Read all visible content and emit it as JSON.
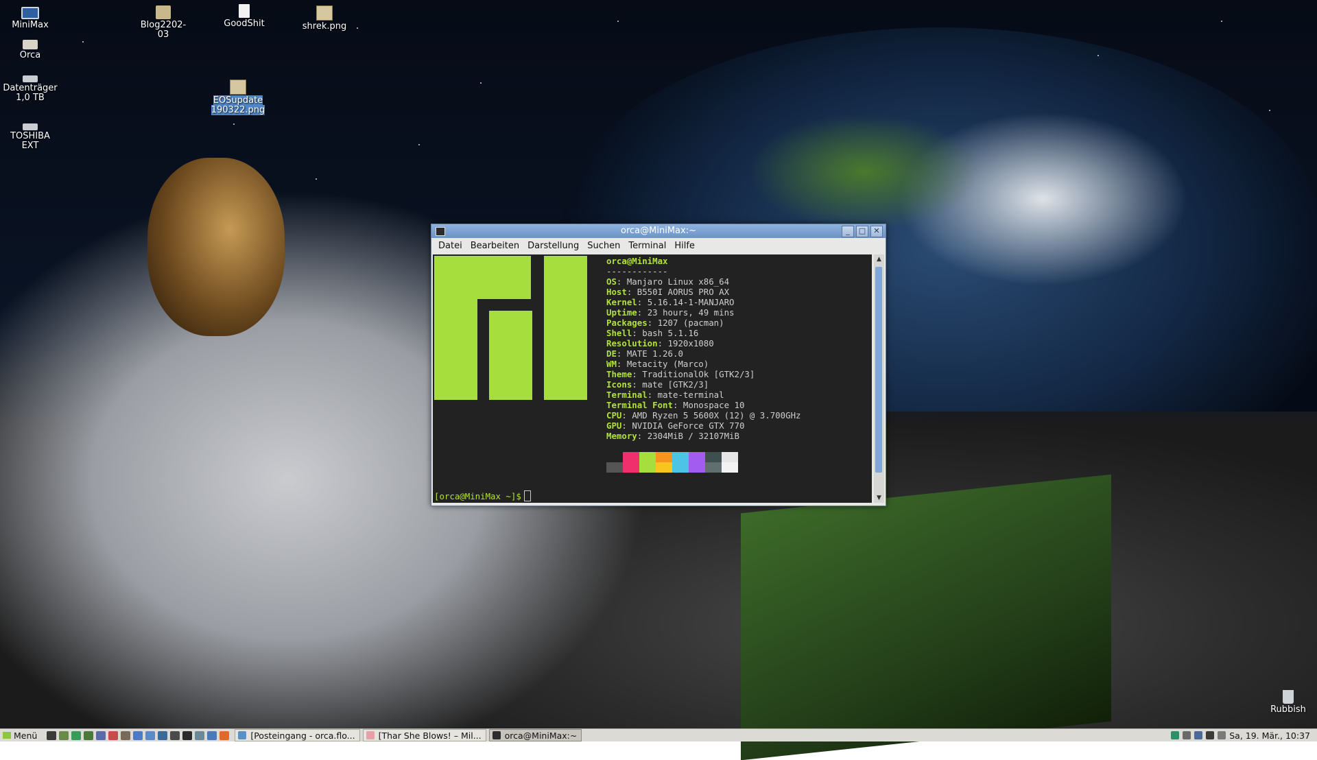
{
  "desktop": {
    "icons": [
      {
        "label": "MiniMax",
        "icon": "computer-icon"
      },
      {
        "label": "Orca",
        "icon": "home-folder-icon"
      },
      {
        "label": "Datenträger 1,0 TB",
        "icon": "drive-icon"
      },
      {
        "label": "TOSHIBA EXT",
        "icon": "drive-icon"
      },
      {
        "label": "Blog2202-03",
        "icon": "folder-icon"
      },
      {
        "label": "GoodShit",
        "icon": "file-icon"
      },
      {
        "label": "shrek.png",
        "icon": "image-icon"
      },
      {
        "label": "EOSupdate190322.png",
        "icon": "image-icon",
        "selected": true
      },
      {
        "label": "Rubbish",
        "icon": "trash-icon"
      }
    ]
  },
  "window": {
    "title": "orca@MiniMax:~",
    "buttons": {
      "minimize": "_",
      "maximize": "□",
      "close": "✕"
    },
    "menu": [
      "Datei",
      "Bearbeiten",
      "Darstellung",
      "Suchen",
      "Terminal",
      "Hilfe"
    ]
  },
  "terminal": {
    "user_host": "orca@MiniMax",
    "separator": "------------",
    "info": [
      {
        "key": "OS",
        "value": "Manjaro Linux x86_64"
      },
      {
        "key": "Host",
        "value": "B550I AORUS PRO AX"
      },
      {
        "key": "Kernel",
        "value": "5.16.14-1-MANJARO"
      },
      {
        "key": "Uptime",
        "value": "23 hours, 49 mins"
      },
      {
        "key": "Packages",
        "value": "1207 (pacman)"
      },
      {
        "key": "Shell",
        "value": "bash 5.1.16"
      },
      {
        "key": "Resolution",
        "value": "1920x1080"
      },
      {
        "key": "DE",
        "value": "MATE 1.26.0"
      },
      {
        "key": "WM",
        "value": "Metacity (Marco)"
      },
      {
        "key": "Theme",
        "value": "TraditionalOk [GTK2/3]"
      },
      {
        "key": "Icons",
        "value": "mate [GTK2/3]"
      },
      {
        "key": "Terminal",
        "value": "mate-terminal"
      },
      {
        "key": "Terminal Font",
        "value": "Monospace 10"
      },
      {
        "key": "CPU",
        "value": "AMD Ryzen 5 5600X (12) @ 3.700GHz"
      },
      {
        "key": "GPU",
        "value": "NVIDIA GeForce GTX 770"
      },
      {
        "key": "Memory",
        "value": "2304MiB / 32107MiB"
      }
    ],
    "palette_top": [
      "#222222",
      "#f0306d",
      "#a6de3d",
      "#f7941e",
      "#4dc4e6",
      "#a35cf0",
      "#3f4f4f",
      "#e6e6e6"
    ],
    "palette_bottom": [
      "#555555",
      "#f0306d",
      "#a6de3d",
      "#f7c51e",
      "#4dc4e6",
      "#a35cf0",
      "#5f6f6f",
      "#f2f2f2"
    ],
    "prompt": "[orca@MiniMax ~]$",
    "accent": "#b2e23c"
  },
  "taskbar": {
    "menu_label": "Menü",
    "launchers": [
      "terminal-icon",
      "text-editor-icon",
      "browser-icon",
      "calculator-icon",
      "settings-icon",
      "mail-icon",
      "archive-icon",
      "document-icon",
      "image-viewer-icon",
      "network-icon",
      "game-icon",
      "steam-icon",
      "screenshot-icon",
      "chat-icon",
      "firefox-icon"
    ],
    "tasks": [
      {
        "label": "[Posteingang - orca.flo...",
        "icon": "mail-icon",
        "active": false
      },
      {
        "label": "[Thar She Blows! – Mil...",
        "icon": "browser-icon",
        "active": false
      },
      {
        "label": "orca@MiniMax:~",
        "icon": "terminal-icon",
        "active": true
      }
    ],
    "clock": "Sa, 19. Mär., 10:37"
  }
}
